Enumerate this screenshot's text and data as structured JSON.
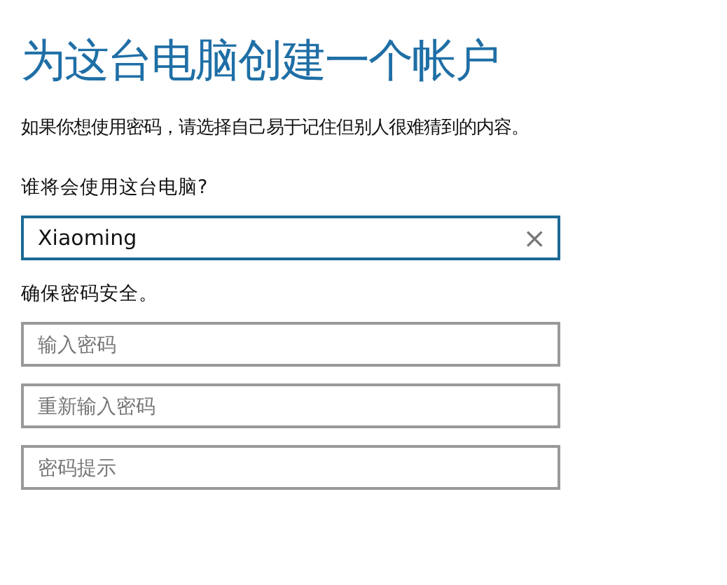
{
  "title": "为这台电脑创建一个帐户",
  "description": "如果你想使用密码，请选择自己易于记住但别人很难猜到的内容。",
  "sections": [
    {
      "label": "谁将会使用这台电脑?",
      "fields": [
        {
          "value": "Xiaoming",
          "clear_icon": "×",
          "focused": true
        }
      ]
    },
    {
      "label": "确保密码安全。",
      "fields": [
        {
          "placeholder": "输入密码",
          "focused": false
        },
        {
          "placeholder": "重新输入密码",
          "focused": false
        },
        {
          "placeholder": "密码提示",
          "focused": false
        }
      ]
    }
  ]
}
